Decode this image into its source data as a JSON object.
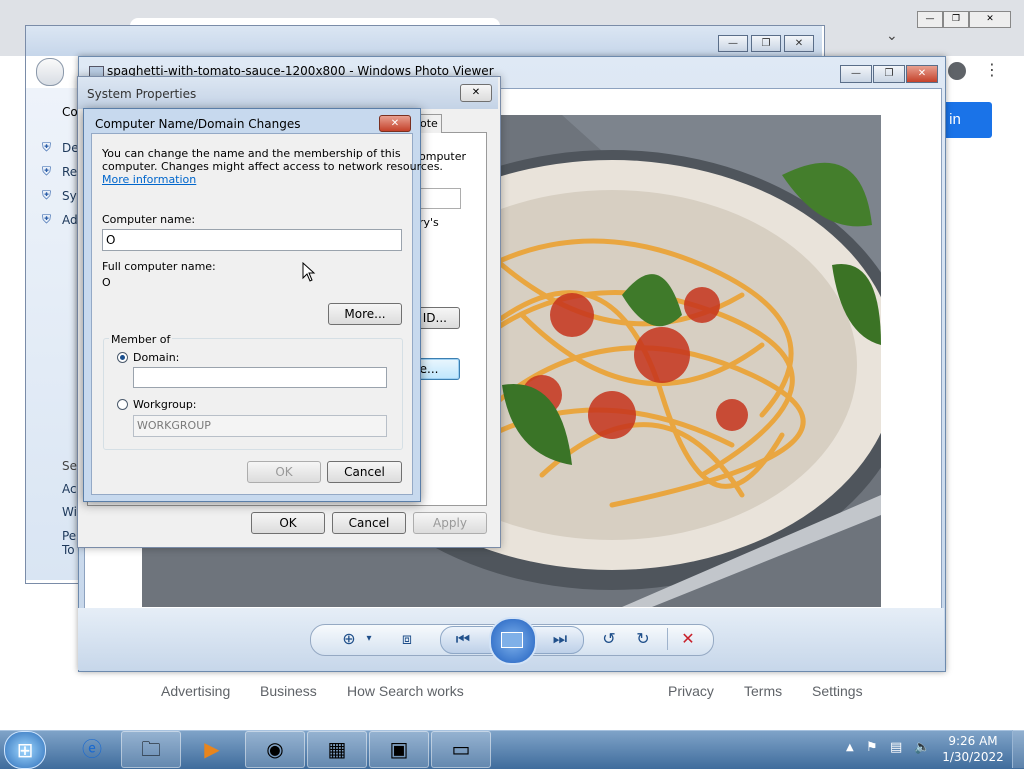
{
  "chrome": {
    "signin_label": "in",
    "footer": [
      "Advertising",
      "Business",
      "How Search works",
      "Privacy",
      "Terms",
      "Settings"
    ],
    "menu_icon": "kebab-menu-icon",
    "profile_icon": "profile-icon"
  },
  "control_panel": {
    "header_fragment": "Co",
    "side_items": [
      "De",
      "Re",
      "Sy",
      "Ad"
    ],
    "see_also": "Se",
    "see_items": [
      "Ac",
      "Wi",
      "Pe",
      "To"
    ]
  },
  "photo_viewer": {
    "title": "spaghetti-with-tomato-sauce-1200x800 - Windows Photo Viewer",
    "help_icon": "help-icon"
  },
  "system_properties": {
    "title": "System Properties",
    "tab_fragment": "note",
    "text_fragment_1": "omputer",
    "text_fragment_2": "ry's",
    "network_id_fragment": "k ID...",
    "change_fragment": "ge...",
    "ok_label": "OK",
    "cancel_label": "Cancel",
    "apply_label": "Apply"
  },
  "dialog": {
    "title": "Computer Name/Domain Changes",
    "description_line1": "You can change the name and the membership of this",
    "description_line2": "computer. Changes might affect access to network resources.",
    "more_info_link": "More information",
    "computer_name_label": "Computer name:",
    "computer_name_value": "O",
    "full_name_label": "Full computer name:",
    "full_name_value": "O",
    "more_button": "More...",
    "member_of_label": "Member of",
    "domain_label": "Domain:",
    "domain_value": "",
    "workgroup_label": "Workgroup:",
    "workgroup_value": "WORKGROUP",
    "ok_label": "OK",
    "cancel_label": "Cancel"
  },
  "taskbar": {
    "time": "9:26 AM",
    "date": "1/30/2022"
  }
}
